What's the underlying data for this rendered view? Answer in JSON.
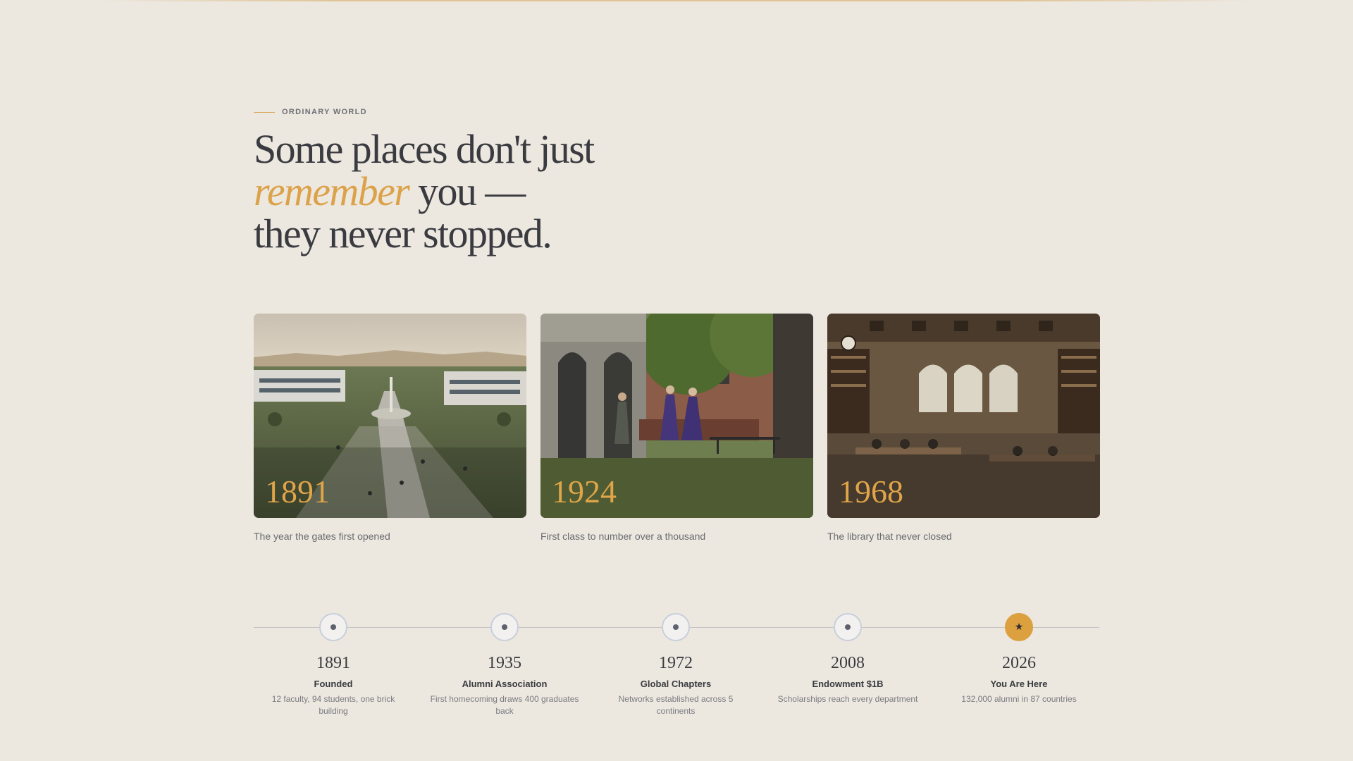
{
  "hero": {
    "eyebrow": "ORDINARY WORLD",
    "headline_line1": "Some places don't just",
    "headline_accent": "remember",
    "headline_line2_rest": " you —",
    "headline_line3": "they never stopped."
  },
  "colors": {
    "background": "#ece7df",
    "accent": "#dca24a",
    "text": "#3a3b40",
    "muted": "#6a6b70"
  },
  "cards": [
    {
      "year": "1891",
      "caption": "The year the gates first opened",
      "image": "campus-aerial-photo"
    },
    {
      "year": "1924",
      "caption": "First class to number over a thousand",
      "image": "graduates-courtyard-photo"
    },
    {
      "year": "1968",
      "caption": "The library that never closed",
      "image": "library-reading-room-photo"
    }
  ],
  "timeline": [
    {
      "year": "1891",
      "title": "Founded",
      "description": "12 faculty, 94 students, one brick building",
      "icon": "dot-icon",
      "current": false
    },
    {
      "year": "1935",
      "title": "Alumni Association",
      "description": "First homecoming draws 400 graduates back",
      "icon": "dot-icon",
      "current": false
    },
    {
      "year": "1972",
      "title": "Global Chapters",
      "description": "Networks established across 5 continents",
      "icon": "dot-icon",
      "current": false
    },
    {
      "year": "2008",
      "title": "Endowment $1B",
      "description": "Scholarships reach every department",
      "icon": "dot-icon",
      "current": false
    },
    {
      "year": "2026",
      "title": "You Are Here",
      "description": "132,000 alumni in 87 countries",
      "icon": "star-icon",
      "current": true
    }
  ]
}
